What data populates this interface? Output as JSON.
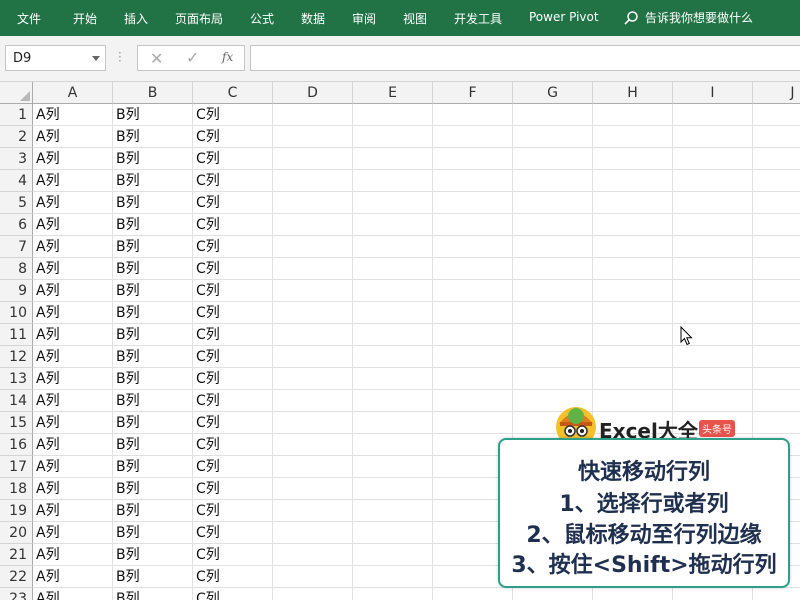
{
  "ribbon": {
    "tabs": [
      "文件",
      "开始",
      "插入",
      "页面布局",
      "公式",
      "数据",
      "审阅",
      "视图",
      "开发工具",
      "Power Pivot"
    ],
    "tell_me": "告诉我你想要做什么"
  },
  "formula_bar": {
    "name_box": "D9",
    "cancel_symbol": "✕",
    "enter_symbol": "✓",
    "fx_label": "fx",
    "formula_value": ""
  },
  "grid": {
    "columns": [
      "A",
      "B",
      "C",
      "D",
      "E",
      "F",
      "G",
      "H",
      "I",
      "J"
    ],
    "rows": [
      {
        "num": "1",
        "a": "A列",
        "b": "B列",
        "c": "C列"
      },
      {
        "num": "2",
        "a": "A列",
        "b": "B列",
        "c": "C列"
      },
      {
        "num": "3",
        "a": "A列",
        "b": "B列",
        "c": "C列"
      },
      {
        "num": "4",
        "a": "A列",
        "b": "B列",
        "c": "C列"
      },
      {
        "num": "5",
        "a": "A列",
        "b": "B列",
        "c": "C列"
      },
      {
        "num": "6",
        "a": "A列",
        "b": "B列",
        "c": "C列"
      },
      {
        "num": "7",
        "a": "A列",
        "b": "B列",
        "c": "C列"
      },
      {
        "num": "8",
        "a": "A列",
        "b": "B列",
        "c": "C列"
      },
      {
        "num": "9",
        "a": "A列",
        "b": "B列",
        "c": "C列"
      },
      {
        "num": "10",
        "a": "A列",
        "b": "B列",
        "c": "C列"
      },
      {
        "num": "11",
        "a": "A列",
        "b": "B列",
        "c": "C列"
      },
      {
        "num": "12",
        "a": "A列",
        "b": "B列",
        "c": "C列"
      },
      {
        "num": "13",
        "a": "A列",
        "b": "B列",
        "c": "C列"
      },
      {
        "num": "14",
        "a": "A列",
        "b": "B列",
        "c": "C列"
      },
      {
        "num": "15",
        "a": "A列",
        "b": "B列",
        "c": "C列"
      },
      {
        "num": "16",
        "a": "A列",
        "b": "B列",
        "c": "C列"
      },
      {
        "num": "17",
        "a": "A列",
        "b": "B列",
        "c": "C列"
      },
      {
        "num": "18",
        "a": "A列",
        "b": "B列",
        "c": "C列"
      },
      {
        "num": "19",
        "a": "A列",
        "b": "B列",
        "c": "C列"
      },
      {
        "num": "20",
        "a": "A列",
        "b": "B列",
        "c": "C列"
      },
      {
        "num": "21",
        "a": "A列",
        "b": "B列",
        "c": "C列"
      },
      {
        "num": "22",
        "a": "A列",
        "b": "B列",
        "c": "C列"
      },
      {
        "num": "23",
        "a": "A列",
        "b": "B列",
        "c": "C列"
      }
    ]
  },
  "watermark": {
    "brand": "Excel大全",
    "badge": "头条号"
  },
  "callout": {
    "lines": [
      "快速移动行列",
      "1、选择行或者列",
      "2、鼠标移动至行列边缘",
      "3、按住<Shift>拖动行列"
    ]
  },
  "colors": {
    "ribbon_bg": "#217346",
    "callout_border": "#2ea08a",
    "callout_text": "#1f2f4f",
    "badge_bg": "#e8534c"
  }
}
